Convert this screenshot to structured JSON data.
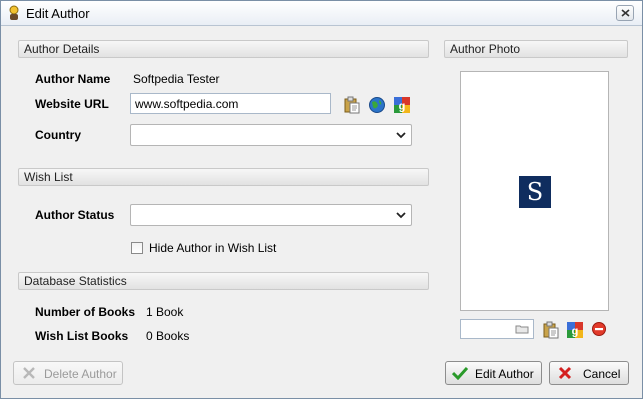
{
  "window": {
    "title": "Edit Author"
  },
  "sections": {
    "author_details": "Author Details",
    "wish_list": "Wish List",
    "database_statistics": "Database Statistics",
    "author_photo": "Author Photo"
  },
  "fields": {
    "author_name_label": "Author Name",
    "author_name_value": "Softpedia Tester",
    "website_url_label": "Website URL",
    "website_url_value": "www.softpedia.com",
    "country_label": "Country",
    "country_value": "",
    "author_status_label": "Author Status",
    "author_status_value": "",
    "hide_author_label": "Hide Author in Wish List",
    "hide_author_checked": false
  },
  "stats": {
    "number_of_books_label": "Number of Books",
    "number_of_books_value": "1 Book",
    "wish_list_books_label": "Wish List Books",
    "wish_list_books_value": "0 Books"
  },
  "photo": {
    "logo_letter": "S",
    "path_value": ""
  },
  "buttons": {
    "delete_author": "Delete Author",
    "edit_author": "Edit Author",
    "cancel": "Cancel"
  },
  "icons": {
    "app": "author-icon",
    "clipboard": "paste-icon",
    "globe": "globe-icon",
    "google": "google-icon",
    "remove": "remove-icon",
    "folder": "folder-icon"
  },
  "colors": {
    "logo_background": "#0f2d5f",
    "section_header": "#e8e8e8",
    "confirm_green": "#2a9a2a",
    "cancel_red": "#d42020"
  }
}
